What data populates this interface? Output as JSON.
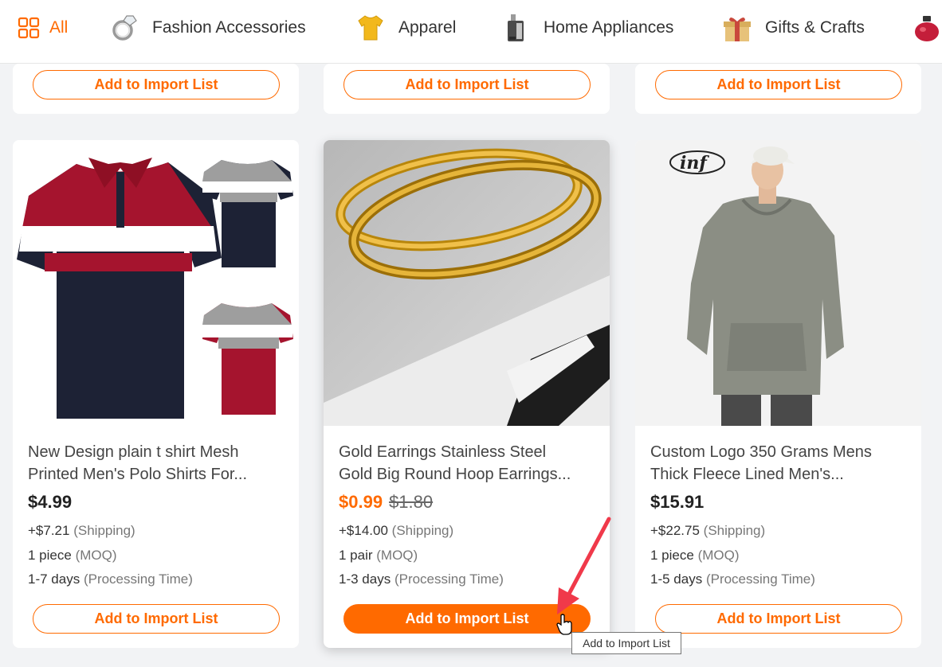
{
  "categories": [
    {
      "label": "All",
      "icon": "grid-icon",
      "active": true
    },
    {
      "label": "Fashion Accessories",
      "icon": "ring-icon"
    },
    {
      "label": "Apparel",
      "icon": "shirt-icon"
    },
    {
      "label": "Home Appliances",
      "icon": "appliance-icon"
    },
    {
      "label": "Gifts & Crafts",
      "icon": "gift-icon"
    },
    {
      "label": "",
      "icon": "perfume-icon"
    }
  ],
  "top_row": {
    "button_label": "Add to Import List"
  },
  "products": [
    {
      "image": "polo-shirt-image",
      "title_line1": "New Design plain t shirt Mesh",
      "title_line2": "Printed Men's Polo Shirts For...",
      "price": "$4.99",
      "shipping": "+$7.21",
      "shipping_label": "(Shipping)",
      "moq": "1 piece",
      "moq_label": "(MOQ)",
      "processing": "1-7 days",
      "processing_label": "(Processing Time)",
      "button_label": "Add to Import List"
    },
    {
      "image": "gold-hoop-earrings-image",
      "title_line1": "Gold Earrings Stainless Steel",
      "title_line2": "Gold Big Round Hoop Earrings...",
      "price": "$0.99",
      "original_price": "$1.80",
      "shipping": "+$14.00",
      "shipping_label": "(Shipping)",
      "moq": "1 pair",
      "moq_label": "(MOQ)",
      "processing": "1-3 days",
      "processing_label": "(Processing Time)",
      "button_label": "Add to Import List"
    },
    {
      "image": "hoodie-model-image",
      "title_line1": "Custom Logo 350 Grams Mens",
      "title_line2": "Thick Fleece Lined Men's...",
      "price": "$15.91",
      "shipping": "+$22.75",
      "shipping_label": "(Shipping)",
      "moq": "1 piece",
      "moq_label": "(MOQ)",
      "processing": "1-5 days",
      "processing_label": "(Processing Time)",
      "button_label": "Add to Import List"
    }
  ],
  "tooltip": "Add to Import List",
  "colors": {
    "accent": "#ff6a00",
    "annotation_arrow": "#f0394a"
  }
}
